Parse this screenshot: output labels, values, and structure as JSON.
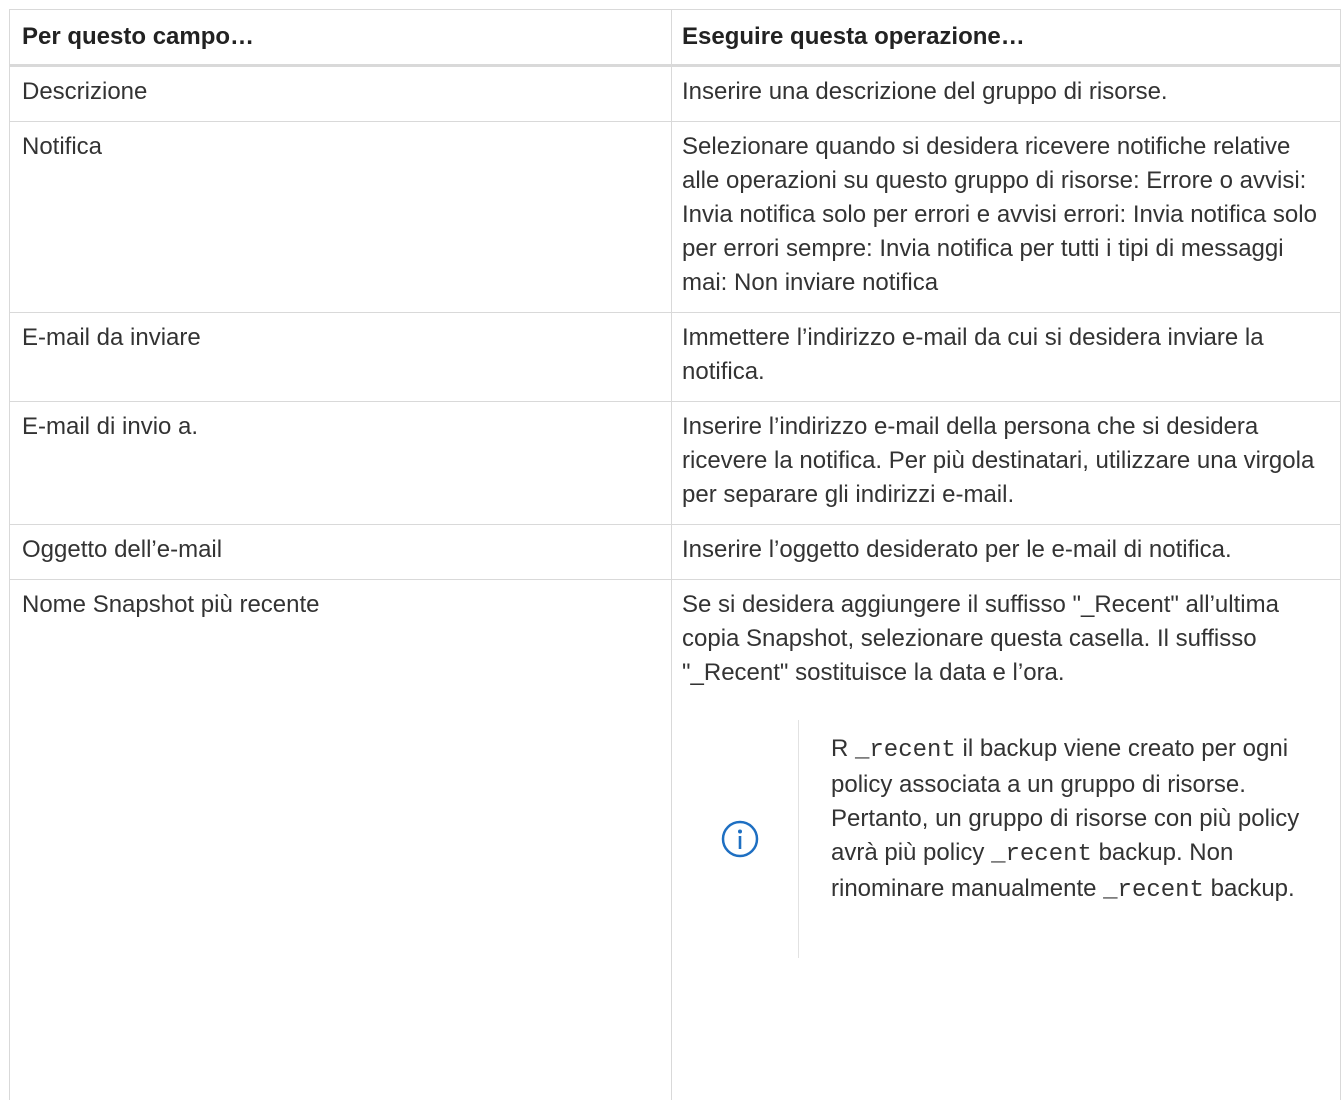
{
  "table": {
    "headers": [
      "Per questo campo…",
      "Eseguire questa operazione…"
    ],
    "rows": [
      {
        "field": "Descrizione",
        "action": "Inserire una descrizione del gruppo di risorse."
      },
      {
        "field": "Notifica",
        "action": "Selezionare quando si desidera ricevere notifiche relative alle operazioni su questo gruppo di risorse: Errore o avvisi: Invia notifica solo per errori e avvisi errori: Invia notifica solo per errori sempre: Invia notifica per tutti i tipi di messaggi mai: Non inviare notifica"
      },
      {
        "field": "E-mail da inviare",
        "action": "Immettere l’indirizzo e-mail da cui si desidera inviare la notifica."
      },
      {
        "field": "E-mail di invio a.",
        "action": "Inserire l’indirizzo e-mail della persona che si desidera ricevere la notifica. Per più destinatari, utilizzare una virgola per separare gli indirizzi e-mail."
      },
      {
        "field": "Oggetto dell’e-mail",
        "action": "Inserire l’oggetto desiderato per le e-mail di notifica."
      },
      {
        "field": "Nome Snapshot più recente",
        "action": "Se si desidera aggiungere il suffisso \"_Recent\" all’ultima copia Snapshot, selezionare questa casella. Il suffisso \"_Recent\" sostituisce la data e l’ora."
      }
    ],
    "note": {
      "icon": "info-icon",
      "t1": "R ",
      "c1": "_recent",
      "t2": " il backup viene creato per ogni policy associata a un gruppo di risorse. Pertanto, un gruppo di risorse con più policy avrà più policy ",
      "c2": "_recent",
      "t3": " backup. Non rinominare manualmente ",
      "c3": "_recent",
      "t4": " backup."
    }
  }
}
